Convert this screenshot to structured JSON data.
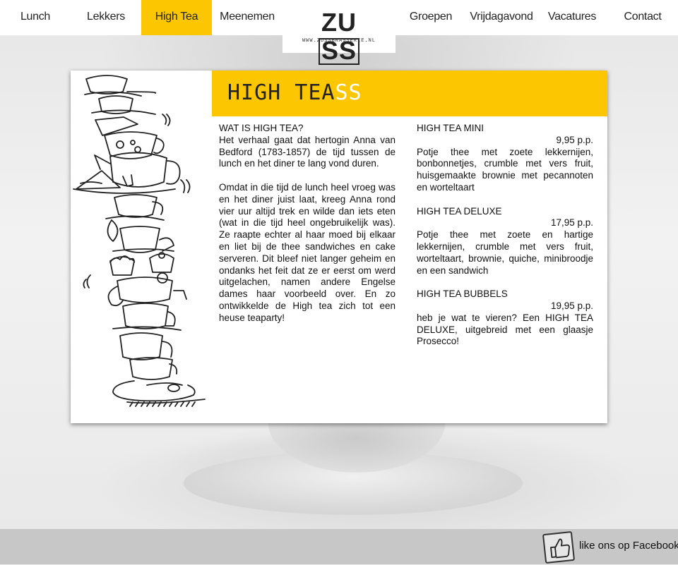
{
  "nav": {
    "left": [
      {
        "label": "Lunch"
      },
      {
        "label": "Lekkers"
      },
      {
        "label": "High Tea"
      },
      {
        "label": "Meenemen"
      }
    ],
    "right": [
      {
        "label": "Groepen"
      },
      {
        "label": "Vrijdagavond"
      },
      {
        "label": "Vacatures"
      },
      {
        "label": "Contact"
      }
    ],
    "active_color": "#fcc700"
  },
  "logo": {
    "text_a": "ZU",
    "text_b": "SS",
    "url": "WWW.ZUSSBRASSERIE.NL"
  },
  "banner": {
    "title_a": "HIGH TEA",
    "title_b": "SS",
    "color": "#fcc700"
  },
  "left_column": {
    "heading": "WAT IS HIGH TEA?",
    "p1": "Het verhaal gaat dat hertogin Anna van Bedford (1783-1857) de tijd tussen de lunch en het diner te lang vond duren.",
    "p2": "Omdat in die tijd de lunch heel vroeg was en het diner juist laat, kreeg Anna rond vier uur altijd trek en wilde dan iets eten (wat in die tijd heel ongebruikelijk was). Ze raapte echter al haar moed bij elkaar en liet bij de thee sandwiches en cake serveren. Dit bleef niet langer geheim en ondanks het feit dat ze er eerst om werd uitgelachen, namen andere Engelse dames haar voorbeeld over. En zo ontwikkelde de High tea zich tot een heuse teaparty!"
  },
  "menu": [
    {
      "name": "HIGH TEA MINI",
      "price": "9,95 p.p.",
      "description": "Potje thee met zoete lekkernijen, bonbonnetjes, crumble met vers fruit, huisgemaakte brownie met pecannoten en worteltaart"
    },
    {
      "name": "HIGH TEA DELUXE",
      "price": "17,95 p.p.",
      "description": "Potje thee met zoete en hartige lekkernijen, crumble met vers fruit, worteltaart, brownie, quiche, minibroodje en een sandwich"
    },
    {
      "name": "HIGH TEA BUBBELS",
      "price": "19,95 p.p.",
      "description": "heb je wat te vieren? Een HIGH TEA DELUXE, uitgebreid met een glaasje Prosecco!"
    }
  ],
  "footer": {
    "facebook_label": "like ons op Facebook",
    "icon": "thumbs-up-icon"
  }
}
